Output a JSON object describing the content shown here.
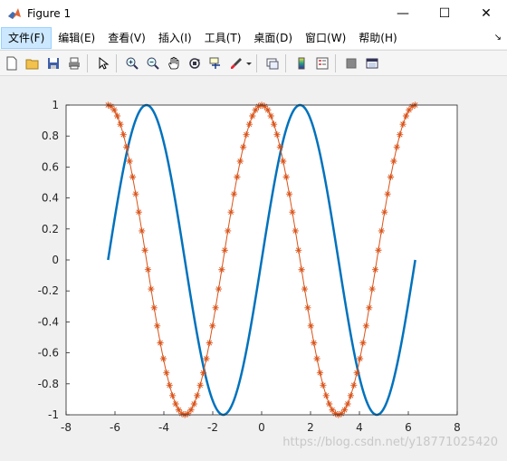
{
  "window": {
    "title": "Figure 1"
  },
  "controls": {
    "minimize": "—",
    "maximize": "☐",
    "close": "✕"
  },
  "menu": {
    "items": [
      {
        "label": "文件(F)"
      },
      {
        "label": "编辑(E)"
      },
      {
        "label": "查看(V)"
      },
      {
        "label": "插入(I)"
      },
      {
        "label": "工具(T)"
      },
      {
        "label": "桌面(D)"
      },
      {
        "label": "窗口(W)"
      },
      {
        "label": "帮助(H)"
      }
    ]
  },
  "toolbar": {
    "icons": [
      "new-figure-icon",
      "open-icon",
      "save-icon",
      "print-icon",
      "pointer-icon",
      "zoom-in-icon",
      "zoom-out-icon",
      "pan-icon",
      "rotate-icon",
      "data-cursor-icon",
      "brush-icon",
      "link-plot-icon",
      "colorbar-icon",
      "legend-icon",
      "hide-plot-tools-icon",
      "show-plot-tools-icon"
    ]
  },
  "chart_data": {
    "type": "line",
    "xlim": [
      -8,
      8
    ],
    "ylim": [
      -1,
      1
    ],
    "xticks": [
      "-8",
      "-6",
      "-4",
      "-2",
      "0",
      "2",
      "4",
      "6",
      "8"
    ],
    "yticks": [
      "1",
      "0.8",
      "0.6",
      "0.4",
      "0.2",
      "0",
      "-0.2",
      "-0.4",
      "-0.6",
      "-0.8",
      "-1"
    ],
    "grid": false,
    "series": [
      {
        "function": "sin",
        "x_range": [
          -6.2832,
          6.2832
        ],
        "color": "#0072bd",
        "marker": "none",
        "line_width": "thick"
      },
      {
        "function": "cos",
        "x_range": [
          -6.2832,
          6.2832
        ],
        "color": "#d95319",
        "marker": "*",
        "points": 101
      }
    ]
  },
  "watermark": "https://blog.csdn.net/y18771025420"
}
